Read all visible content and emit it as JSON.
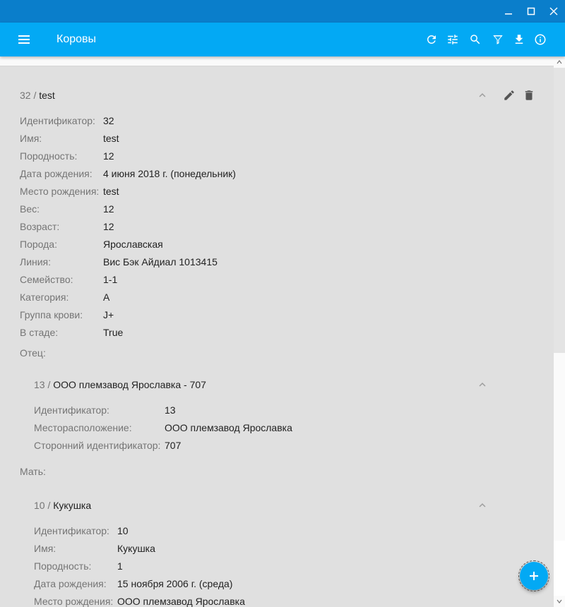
{
  "window": {
    "controls": [
      "minimize-icon",
      "maximize-icon",
      "close-icon"
    ]
  },
  "appbar": {
    "title": "Коровы",
    "tools": [
      "refresh-icon",
      "tune-icon",
      "search-icon",
      "filter-icon",
      "download-icon",
      "info-icon"
    ]
  },
  "record": {
    "id_prefix": "32 /",
    "name": "test",
    "fields": [
      {
        "label": "Идентификатор:",
        "value": "32"
      },
      {
        "label": "Имя:",
        "value": "test"
      },
      {
        "label": "Породность:",
        "value": "12"
      },
      {
        "label": "Дата рождения:",
        "value": "4 июня 2018 г. (понедельник)"
      },
      {
        "label": "Место рождения:",
        "value": "test"
      },
      {
        "label": "Вес:",
        "value": "12"
      },
      {
        "label": "Возраст:",
        "value": "12"
      },
      {
        "label": "Порода:",
        "value": "Ярославская"
      },
      {
        "label": "Линия:",
        "value": "Вис Бэк Айдиал 1013415"
      },
      {
        "label": "Семейство:",
        "value": "1-1"
      },
      {
        "label": "Категория:",
        "value": "A"
      },
      {
        "label": "Группа крови:",
        "value": "J+"
      },
      {
        "label": "В стаде:",
        "value": "True"
      }
    ],
    "father_label": "Отец:",
    "father": {
      "id_prefix": "13 /",
      "name": "ООО племзавод Ярославка - 707",
      "fields": [
        {
          "label": "Идентификатор:",
          "value": "13"
        },
        {
          "label": "Месторасположение:",
          "value": "ООО племзавод Ярославка"
        },
        {
          "label": "Сторонний идентификатор:",
          "value": "707"
        }
      ]
    },
    "mother_label": "Мать:",
    "mother": {
      "id_prefix": "10 /",
      "name": "Кукушка",
      "fields": [
        {
          "label": "Идентификатор:",
          "value": "10"
        },
        {
          "label": "Имя:",
          "value": "Кукушка"
        },
        {
          "label": "Породность:",
          "value": "1"
        },
        {
          "label": "Дата рождения:",
          "value": "15 ноября 2006 г. (среда)"
        },
        {
          "label": "Место рождения:",
          "value": "ООО племзавод Ярославка"
        }
      ]
    }
  },
  "colors": {
    "appbar": "#03a9f4",
    "titlebar": "#0a7ecb",
    "background": "#e0e0e0"
  }
}
